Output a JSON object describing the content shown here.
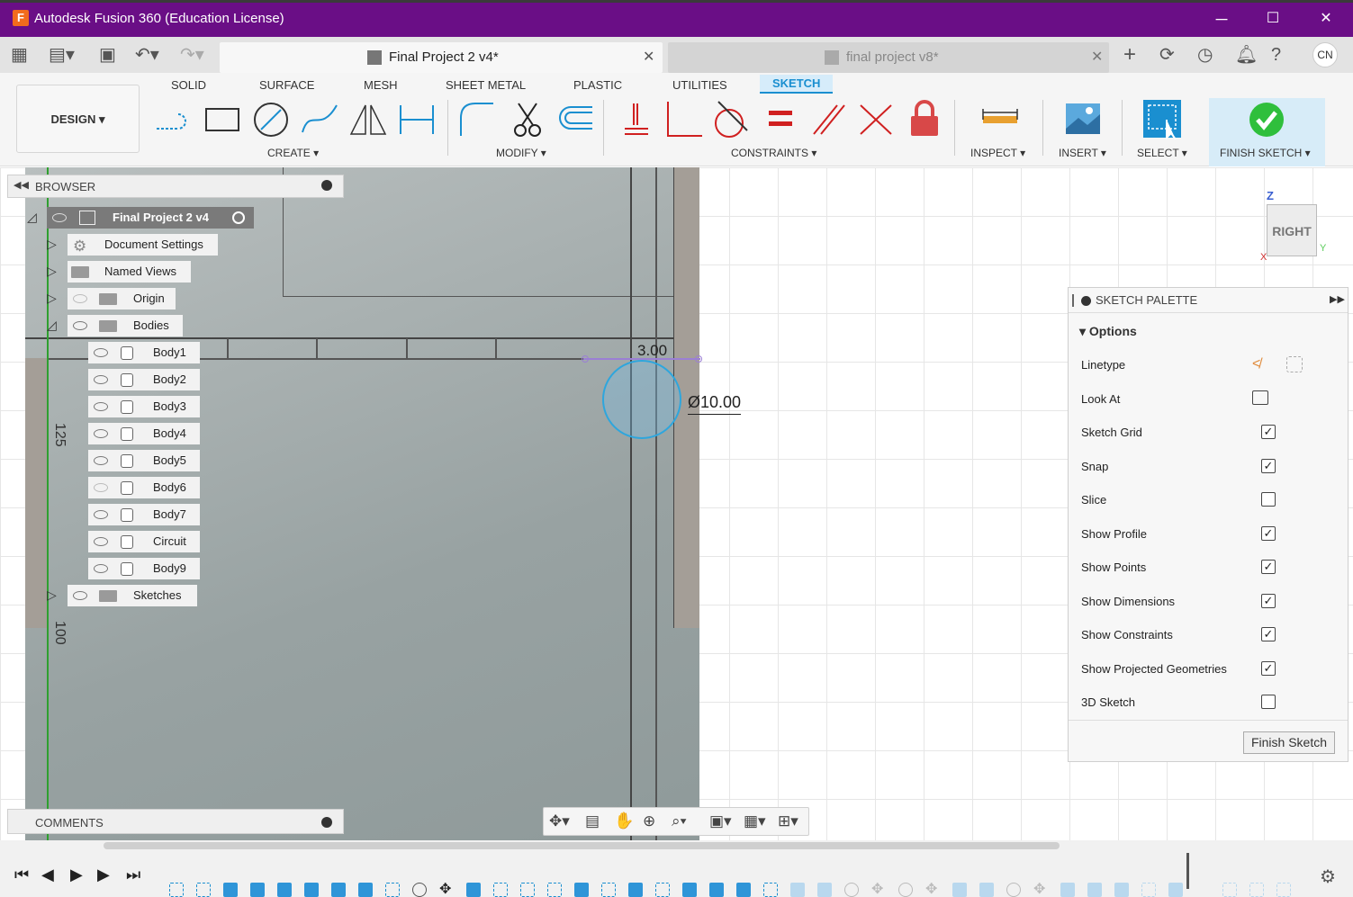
{
  "window": {
    "title": "Autodesk Fusion 360 (Education License)",
    "logo": "F",
    "minimize": "─",
    "maximize": "☐",
    "close": "✕"
  },
  "tabs": {
    "active": "Final Project 2 v4*",
    "inactive": "final project v8*",
    "user": "CN"
  },
  "ribbon": {
    "workspace": "DESIGN",
    "tabs": [
      "SOLID",
      "SURFACE",
      "MESH",
      "SHEET METAL",
      "PLASTIC",
      "UTILITIES",
      "SKETCH"
    ],
    "groups": {
      "create": "CREATE",
      "modify": "MODIFY",
      "constraints": "CONSTRAINTS",
      "inspect": "INSPECT",
      "insert": "INSERT",
      "select": "SELECT",
      "finish": "FINISH SKETCH"
    }
  },
  "browser": {
    "title": "BROWSER",
    "root": "Final Project 2 v4",
    "items": [
      "Document Settings",
      "Named Views",
      "Origin",
      "Bodies",
      "Body1",
      "Body2",
      "Body3",
      "Body4",
      "Body5",
      "Body6",
      "Body7",
      "Circuit",
      "Body9",
      "Sketches"
    ]
  },
  "viewcube": {
    "face": "RIGHT",
    "z": "Z",
    "y": "Y",
    "x": "X"
  },
  "dimensions": {
    "d1": "3.00",
    "d2": "Ø10.00",
    "ruler1": "125",
    "ruler2": "100"
  },
  "palette": {
    "title": "SKETCH PALETTE",
    "section": "Options",
    "rows": [
      {
        "label": "Linetype",
        "value": ""
      },
      {
        "label": "Look At",
        "value": ""
      },
      {
        "label": "Sketch Grid",
        "value": "✓"
      },
      {
        "label": "Snap",
        "value": "✓"
      },
      {
        "label": "Slice",
        "value": ""
      },
      {
        "label": "Show Profile",
        "value": "✓"
      },
      {
        "label": "Show Points",
        "value": "✓"
      },
      {
        "label": "Show Dimensions",
        "value": "✓"
      },
      {
        "label": "Show Constraints",
        "value": "✓"
      },
      {
        "label": "Show Projected Geometries",
        "value": "✓"
      },
      {
        "label": "3D Sketch",
        "value": ""
      }
    ],
    "finish_button": "Finish Sketch"
  },
  "comments": {
    "title": "COMMENTS"
  },
  "colors": {
    "title_bar": "#6a0e86",
    "accent": "#1a8fd0",
    "finish": "#2fbf3c"
  }
}
